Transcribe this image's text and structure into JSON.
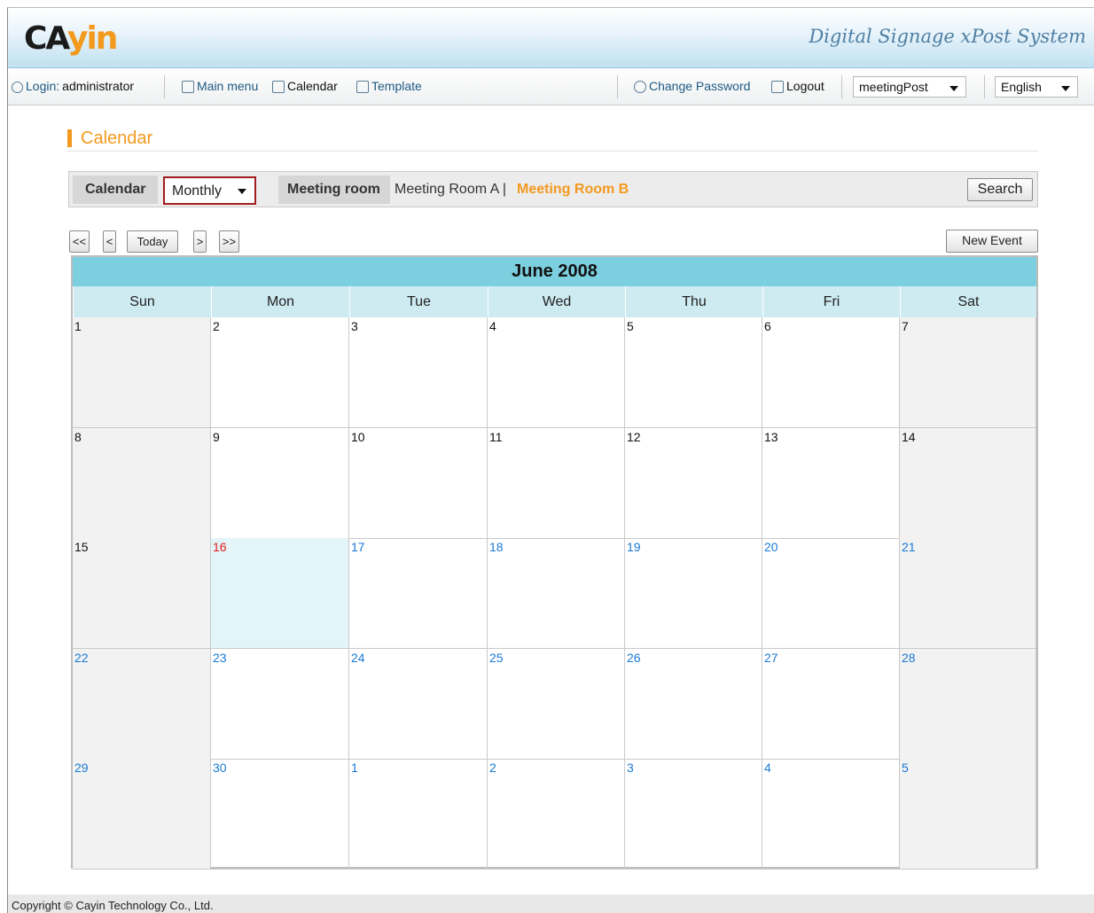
{
  "header": {
    "logo_main": "CA",
    "logo_y": "y",
    "logo_in": "in",
    "tagline": "Digital Signage xPost System"
  },
  "nav": {
    "login_prefix": "Login:",
    "login_user": "administrator",
    "main_menu": "Main menu",
    "calendar": "Calendar",
    "template": "Template",
    "change_password": "Change Password",
    "logout": "Logout",
    "app_select": "meetingPost",
    "language_select": "English"
  },
  "page": {
    "title": "Calendar"
  },
  "filter": {
    "calendar_label": "Calendar",
    "view_select": "Monthly",
    "room_label": "Meeting room",
    "rooms": [
      "Meeting Room A |",
      "Meeting Room B"
    ],
    "selected_room": "Meeting Room B",
    "search_button": "Search"
  },
  "toolbar": {
    "first": "<<",
    "prev": "<",
    "today": "Today",
    "next": ">",
    "last": ">>",
    "new_event": "New Event"
  },
  "calendar": {
    "month_title": "June 2008",
    "weekdays": [
      "Sun",
      "Mon",
      "Tue",
      "Wed",
      "Thu",
      "Fri",
      "Sat"
    ],
    "weeks": [
      [
        "1",
        "2",
        "3",
        "4",
        "5",
        "6",
        "7"
      ],
      [
        "8",
        "9",
        "10",
        "11",
        "12",
        "13",
        "14"
      ],
      [
        "15",
        "16",
        "17",
        "18",
        "19",
        "20",
        "21"
      ],
      [
        "22",
        "23",
        "24",
        "25",
        "26",
        "27",
        "28"
      ],
      [
        "29",
        "30",
        "1",
        "2",
        "3",
        "4",
        "5"
      ]
    ],
    "today": "16",
    "colors": {
      "past": "#111111",
      "today": "#e31b1b",
      "future": "#1a7ad4",
      "header": "#7ccfdf",
      "weekday_row": "#cdebf1"
    }
  },
  "footer": {
    "copyright": "Copyright © Cayin Technology Co., Ltd."
  }
}
